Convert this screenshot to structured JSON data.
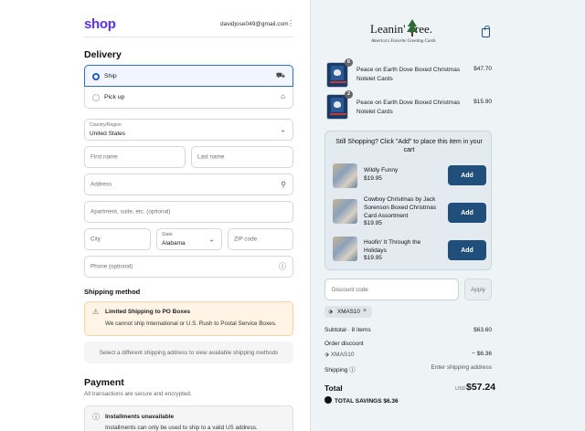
{
  "header": {
    "logo": "shop",
    "email": "davidjose049@gmail.com",
    "menu": "⋮"
  },
  "delivery": {
    "title": "Delivery",
    "options": [
      {
        "label": "Ship",
        "selected": true,
        "icon": "truck-icon"
      },
      {
        "label": "Pick up",
        "selected": false,
        "icon": "store-icon"
      }
    ],
    "country": {
      "label": "Country/Region",
      "value": "United States"
    },
    "first_name": {
      "placeholder": "First name"
    },
    "last_name": {
      "placeholder": "Last name"
    },
    "address": {
      "placeholder": "Address"
    },
    "apartment": {
      "placeholder": "Apartment, suite, etc. (optional)"
    },
    "city": {
      "placeholder": "City"
    },
    "state": {
      "label": "State",
      "value": "Alabama"
    },
    "zip": {
      "placeholder": "ZIP code"
    },
    "phone": {
      "placeholder": "Phone (optional)"
    }
  },
  "shipping_method": {
    "title": "Shipping method",
    "warning_title": "Limited Shipping to PO Boxes",
    "warning_text": "We cannot ship International or U.S. Rush to Postal Service Boxes.",
    "note": "Select a different shipping address to view available shipping methods"
  },
  "payment": {
    "title": "Payment",
    "subtitle": "All transactions are secure and encrypted.",
    "installments_title": "Installments unavailable",
    "installments_text": "Installments can only be used to ship to a valid US address."
  },
  "brand": {
    "name": "Leanin' Tree.",
    "tagline": "America's Favorite Greeting Cards"
  },
  "cart_items": [
    {
      "name": "Peace on Earth Dove Boxed Christmas Notelet Cards",
      "qty": "6",
      "price": "$47.70"
    },
    {
      "name": "Peace on Earth Dove Boxed Christmas Notelet Cards",
      "qty": "2",
      "price": "$15.90"
    }
  ],
  "upsell": {
    "heading": "Still Shopping? Click \"Add\" to place this item in your cart",
    "items": [
      {
        "name": "Wildly Funny",
        "price": "$19.95",
        "button": "Add"
      },
      {
        "name": "Cowboy Christmas by Jack Sorenson Boxed Christmas Card Assortment",
        "price": "$19.95",
        "button": "Add"
      },
      {
        "name": "Hoofin' It Through the Holidays",
        "price": "$19.95",
        "button": "Add"
      }
    ]
  },
  "discount": {
    "placeholder": "Discount code",
    "apply": "Apply",
    "code": "XMAS10"
  },
  "summary": {
    "subtotal_label": "Subtotal · 8 items",
    "subtotal": "$63.60",
    "order_discount_label": "Order discount",
    "discount_code": "XMAS10",
    "discount_value": "− $6.36",
    "shipping_label": "Shipping",
    "shipping_value": "Enter shipping address",
    "total_label": "Total",
    "currency": "USD",
    "total": "$57.24",
    "savings_label": "TOTAL SAVINGS",
    "savings": "$6.36"
  },
  "colors": {
    "accent": "#1f4f7a",
    "shop_purple": "#5a31f4",
    "warning_bg": "#fff4e5"
  }
}
